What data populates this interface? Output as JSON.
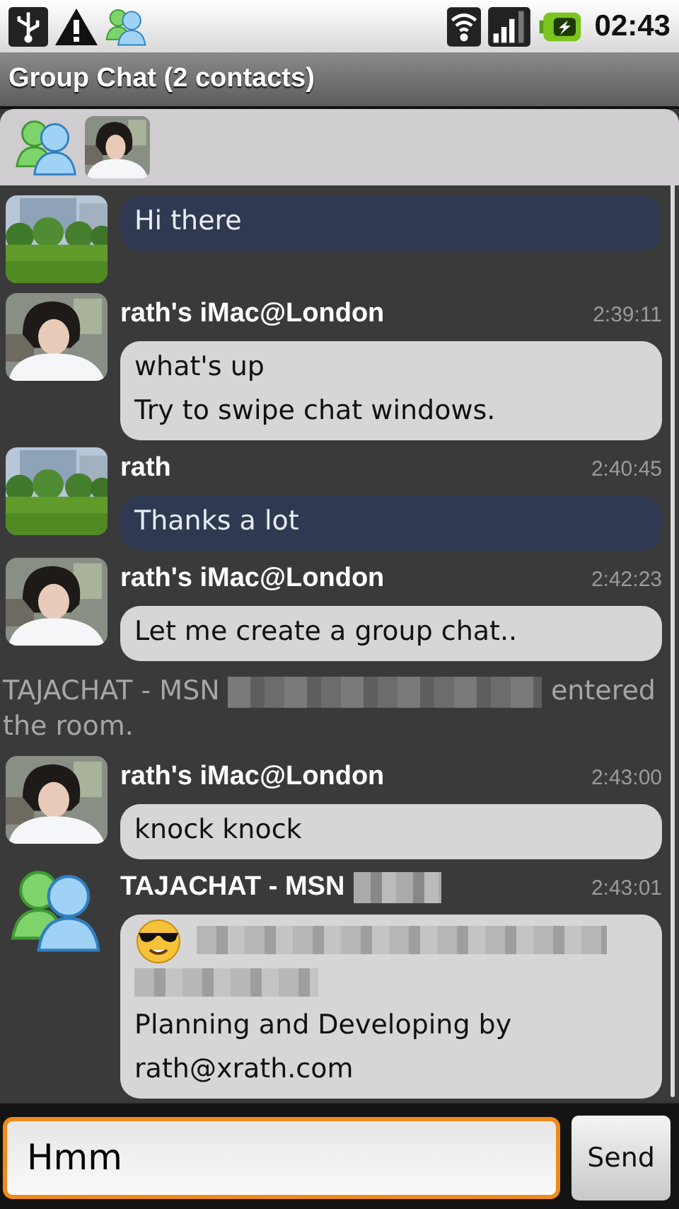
{
  "status_bar": {
    "time": "02:43"
  },
  "window": {
    "title": "Group Chat (2 contacts)"
  },
  "contacts": [
    {
      "avatar": {
        "kind": "buddies"
      }
    },
    {
      "avatar": {
        "kind": "person"
      }
    }
  ],
  "messages": [
    {
      "kind": "message",
      "avatar": {
        "kind": "park"
      },
      "outgoing": true,
      "lines": [
        {
          "kind": "text",
          "text": "Hi there"
        }
      ]
    },
    {
      "kind": "message",
      "avatar": {
        "kind": "person"
      },
      "name": "rath's iMac@London",
      "time": "2:39:11",
      "outgoing": false,
      "lines": [
        {
          "kind": "text",
          "text": "what's up"
        },
        {
          "kind": "text",
          "text": "Try to swipe chat windows."
        }
      ]
    },
    {
      "kind": "message",
      "avatar": {
        "kind": "park"
      },
      "name": "rath",
      "time": "2:40:45",
      "outgoing": true,
      "lines": [
        {
          "kind": "text",
          "text": "Thanks a lot"
        }
      ]
    },
    {
      "kind": "message",
      "avatar": {
        "kind": "person"
      },
      "name": "rath's iMac@London",
      "time": "2:42:23",
      "outgoing": false,
      "lines": [
        {
          "kind": "text",
          "text": "Let me create a group chat.."
        }
      ]
    },
    {
      "kind": "system",
      "before": "TAJACHAT - MSN",
      "after": "entered the room."
    },
    {
      "kind": "message",
      "avatar": {
        "kind": "person"
      },
      "name": "rath's iMac@London",
      "time": "2:43:00",
      "outgoing": false,
      "lines": [
        {
          "kind": "text",
          "text": "knock knock"
        }
      ]
    },
    {
      "kind": "message",
      "avatar": {
        "kind": "buddies"
      },
      "name": "TAJACHAT - MSN",
      "name_blurred": true,
      "time": "2:43:01",
      "outgoing": false,
      "lines": [
        {
          "kind": "emoji_blur"
        },
        {
          "kind": "blur"
        },
        {
          "kind": "text",
          "text": "Planning and Developing by rath@xrath.com"
        }
      ]
    }
  ],
  "composer": {
    "value": "Hmm",
    "send": "Send"
  }
}
